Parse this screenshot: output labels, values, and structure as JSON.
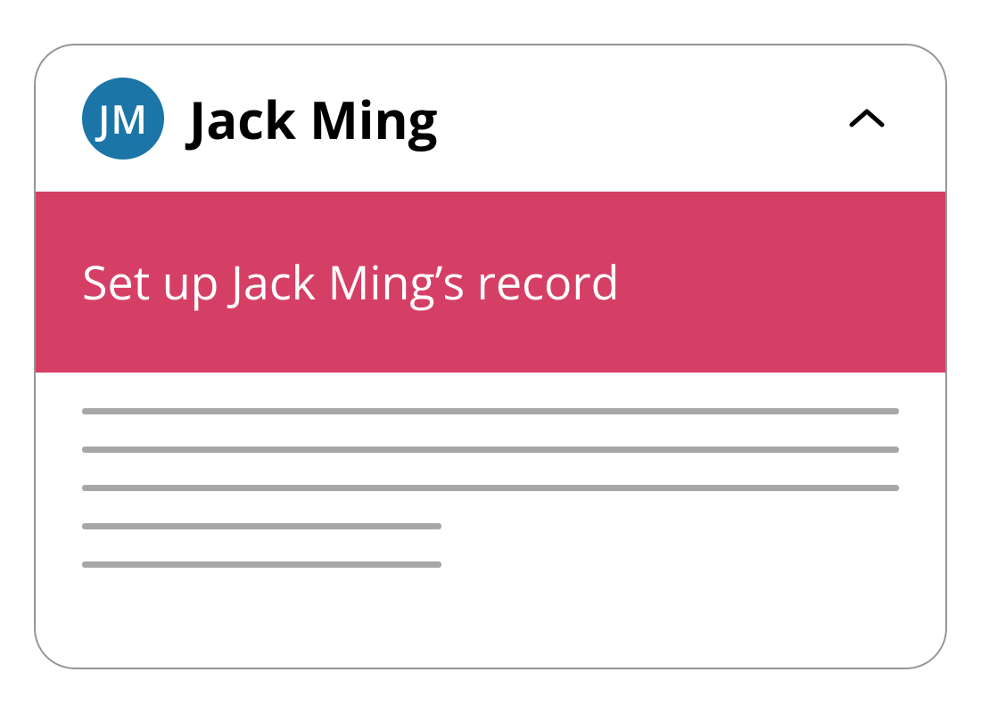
{
  "header": {
    "avatar_initials": "JM",
    "person_name": "Jack Ming",
    "avatar_bg": "#1b75a7"
  },
  "banner": {
    "title": "Set up Jack Ming’s record",
    "bg": "#d53f65"
  }
}
